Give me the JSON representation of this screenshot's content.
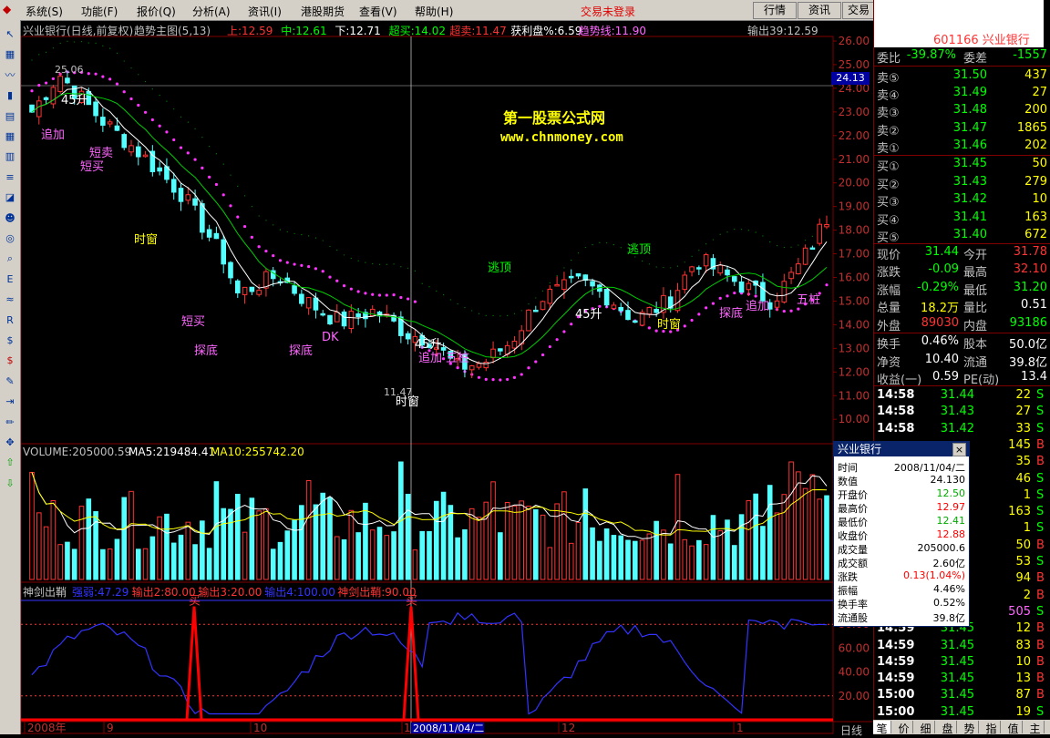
{
  "menu": {
    "items": [
      "系统(S)",
      "功能(F)",
      "报价(Q)",
      "分析(A)",
      "资讯(I)",
      "港股期货",
      "查看(V)",
      "帮助(H)"
    ],
    "login_status": "交易未登录",
    "buttons": [
      "行情",
      "资讯",
      "交易"
    ]
  },
  "toolbar": {
    "icons": [
      "arrow-icon",
      "tile-icon",
      "line-icon",
      "bar-icon",
      "ranking-icon",
      "grid-icon",
      "table-icon",
      "list-icon",
      "chart-icon",
      "people-icon",
      "index-icon",
      "search-icon",
      "etf-icon",
      "wave-icon",
      "rsi-icon",
      "money-icon",
      "dollar-icon",
      "wrench-icon",
      "exit-icon",
      "pencil-icon",
      "move-icon",
      "up-icon",
      "down-icon"
    ]
  },
  "chart": {
    "title": "兴业银行(日线,前复权)",
    "indicator_name": "趋势主图(5,13)",
    "vals": [
      {
        "text": "上:12.59",
        "color": "#ff3333"
      },
      {
        "text": "中:12.61",
        "color": "#00ff00"
      },
      {
        "text": "下:12.71",
        "color": "#ffffff"
      },
      {
        "text": "超买:14.02",
        "color": "#00ff00"
      },
      {
        "text": "超卖:11.47",
        "color": "#ff3333"
      },
      {
        "text": "获利盘%:6.59",
        "color": "#ffffff"
      },
      {
        "text": "趋势线:11.90",
        "color": "#ff66ff"
      }
    ],
    "output": "输出39:12.59",
    "watermark1": "第一股票公式网",
    "watermark2": "www.chnmoney.com",
    "price_axis": [
      "26.00",
      "25.00",
      "24.00",
      "23.00",
      "22.00",
      "21.00",
      "20.00",
      "19.00",
      "18.00",
      "17.00",
      "16.00",
      "15.00",
      "14.00",
      "13.00",
      "12.00",
      "11.00",
      "10.00"
    ],
    "cursor_price": "24.13",
    "high_label": "25.06",
    "low_label": "11.47",
    "annotations": [
      {
        "text": "45升",
        "color": "#ffffff"
      },
      {
        "text": "追加",
        "color": "#ff66ff"
      },
      {
        "text": "短买",
        "color": "#ff66ff"
      },
      {
        "text": "短卖",
        "color": "#ff66ff"
      },
      {
        "text": "时窗",
        "color": "#ffff00"
      },
      {
        "text": "短买",
        "color": "#ff66ff"
      },
      {
        "text": "探底",
        "color": "#ff66ff"
      },
      {
        "text": "探底",
        "color": "#ff66ff"
      },
      {
        "text": "DK",
        "color": "#ff66ff"
      },
      {
        "text": "时窗",
        "color": "#ffffff"
      },
      {
        "text": "45升",
        "color": "#ffffff"
      },
      {
        "text": "追加",
        "color": "#ff66ff"
      },
      {
        "text": "五桩",
        "color": "#ff66ff"
      },
      {
        "text": "逃顶",
        "color": "#00ff00"
      },
      {
        "text": "逃顶",
        "color": "#00ff00"
      },
      {
        "text": "45升",
        "color": "#ffffff"
      },
      {
        "text": "时窗",
        "color": "#ffff00"
      },
      {
        "text": "探底",
        "color": "#ff66ff"
      },
      {
        "text": "追加",
        "color": "#ff66ff"
      },
      {
        "text": "五桩",
        "color": "#ff66ff"
      }
    ],
    "volume_label": "VOLUME:205000.59",
    "ma5_label": "MA5:219484.41",
    "ma10_label": "MA10:255742.20",
    "osc_name": "神剑出鞘",
    "osc_vals": [
      {
        "text": "强弱:47.29",
        "color": "#3333ff"
      },
      {
        "text": "输出2:80.00",
        "color": "#ff3333"
      },
      {
        "text": "输出3:20.00",
        "color": "#ff3333"
      },
      {
        "text": "输出4:100.00",
        "color": "#3333ff"
      },
      {
        "text": "神剑出鞘:90.00",
        "color": "#ff3333"
      }
    ],
    "osc_axis": [
      "80.00",
      "60.00",
      "40.00",
      "20.00"
    ],
    "buy_marker": "买",
    "date_axis": [
      "2008年",
      "9",
      "10",
      "11",
      "2008/11/04/二",
      "12",
      "1"
    ],
    "period": "日线"
  },
  "panel": {
    "code_name": "601166 兴业银行",
    "weibi": {
      "label": "委比",
      "value": "-39.87%",
      "label2": "委差",
      "value2": "-1557"
    },
    "sell": [
      {
        "label": "卖⑤",
        "price": "31.50",
        "vol": "437"
      },
      {
        "label": "卖④",
        "price": "31.49",
        "vol": "27"
      },
      {
        "label": "卖③",
        "price": "31.48",
        "vol": "200"
      },
      {
        "label": "卖②",
        "price": "31.47",
        "vol": "1865"
      },
      {
        "label": "卖①",
        "price": "31.46",
        "vol": "202"
      }
    ],
    "buy": [
      {
        "label": "买①",
        "price": "31.45",
        "vol": "50"
      },
      {
        "label": "买②",
        "price": "31.43",
        "vol": "279"
      },
      {
        "label": "买③",
        "price": "31.42",
        "vol": "10"
      },
      {
        "label": "买④",
        "price": "31.41",
        "vol": "163"
      },
      {
        "label": "买⑤",
        "price": "31.40",
        "vol": "672"
      }
    ],
    "stats": [
      {
        "k1": "现价",
        "v1": "31.44",
        "c1": "#00ff00",
        "k2": "今开",
        "v2": "31.78",
        "c2": "#ff3333"
      },
      {
        "k1": "涨跌",
        "v1": "-0.09",
        "c1": "#00ff00",
        "k2": "最高",
        "v2": "32.10",
        "c2": "#ff3333"
      },
      {
        "k1": "涨幅",
        "v1": "-0.29%",
        "c1": "#00ff00",
        "k2": "最低",
        "v2": "31.20",
        "c2": "#00ff00"
      },
      {
        "k1": "总量",
        "v1": "18.2万",
        "c1": "#ffff00",
        "k2": "量比",
        "v2": "0.51",
        "c2": "#ffffff"
      },
      {
        "k1": "外盘",
        "v1": "89030",
        "c1": "#ff3333",
        "k2": "内盘",
        "v2": "93186",
        "c2": "#00ff00"
      }
    ],
    "stats2": [
      {
        "k1": "换手",
        "v1": "0.46%",
        "k2": "股本",
        "v2": "50.0亿"
      },
      {
        "k1": "净资",
        "v1": "10.40",
        "k2": "流通",
        "v2": "39.8亿"
      },
      {
        "k1": "收益(一)",
        "v1": "0.59",
        "k2": "PE(动)",
        "v2": "13.4"
      }
    ],
    "ticks": [
      {
        "t": "14:58",
        "p": "31.44",
        "v": "22",
        "s": "S"
      },
      {
        "t": "14:58",
        "p": "31.43",
        "v": "27",
        "s": "S"
      },
      {
        "t": "14:58",
        "p": "31.42",
        "v": "33",
        "s": "S"
      },
      {
        "t": "",
        "p": "",
        "v": "145",
        "s": "B"
      },
      {
        "t": "",
        "p": "",
        "v": "35",
        "s": "B"
      },
      {
        "t": "",
        "p": "",
        "v": "46",
        "s": "S"
      },
      {
        "t": "",
        "p": "",
        "v": "1",
        "s": "S"
      },
      {
        "t": "",
        "p": "",
        "v": "163",
        "s": "S"
      },
      {
        "t": "",
        "p": "",
        "v": "1",
        "s": "S"
      },
      {
        "t": "",
        "p": "",
        "v": "50",
        "s": "B"
      },
      {
        "t": "",
        "p": "",
        "v": "53",
        "s": "S"
      },
      {
        "t": "",
        "p": "",
        "v": "94",
        "s": "B"
      },
      {
        "t": "",
        "p": "",
        "v": "2",
        "s": "B"
      },
      {
        "t": "",
        "p": "",
        "v": "505",
        "s": "S"
      },
      {
        "t": "14:59",
        "p": "31.45",
        "v": "12",
        "s": "B"
      },
      {
        "t": "14:59",
        "p": "31.45",
        "v": "83",
        "s": "B"
      },
      {
        "t": "14:59",
        "p": "31.45",
        "v": "10",
        "s": "B"
      },
      {
        "t": "14:59",
        "p": "31.45",
        "v": "13",
        "s": "B"
      },
      {
        "t": "15:00",
        "p": "31.45",
        "v": "87",
        "s": "B"
      },
      {
        "t": "15:00",
        "p": "31.45",
        "v": "19",
        "s": "S"
      }
    ],
    "tabs": [
      "笔",
      "价",
      "细",
      "盘",
      "势",
      "指",
      "值",
      "主"
    ]
  },
  "popup": {
    "title": "兴业银行",
    "close": "×",
    "rows": [
      {
        "k": "时间",
        "v": "2008/11/04/二",
        "c": "#000000"
      },
      {
        "k": "数值",
        "v": "24.130",
        "c": "#000000"
      },
      {
        "k": "开盘价",
        "v": "12.50",
        "c": "#00aa00"
      },
      {
        "k": "最高价",
        "v": "12.97",
        "c": "#ff0000"
      },
      {
        "k": "最低价",
        "v": "12.41",
        "c": "#00aa00"
      },
      {
        "k": "收盘价",
        "v": "12.88",
        "c": "#ff0000"
      },
      {
        "k": "成交量",
        "v": "205000.6",
        "c": "#000000"
      },
      {
        "k": "成交额",
        "v": "2.60亿",
        "c": "#000000"
      },
      {
        "k": "涨跌",
        "v": "0.13(1.04%)",
        "c": "#ff0000"
      },
      {
        "k": "振幅",
        "v": "4.46%",
        "c": "#000000"
      },
      {
        "k": "换手率",
        "v": "0.52%",
        "c": "#000000"
      },
      {
        "k": "流通股",
        "v": "39.8亿",
        "c": "#000000"
      }
    ]
  }
}
